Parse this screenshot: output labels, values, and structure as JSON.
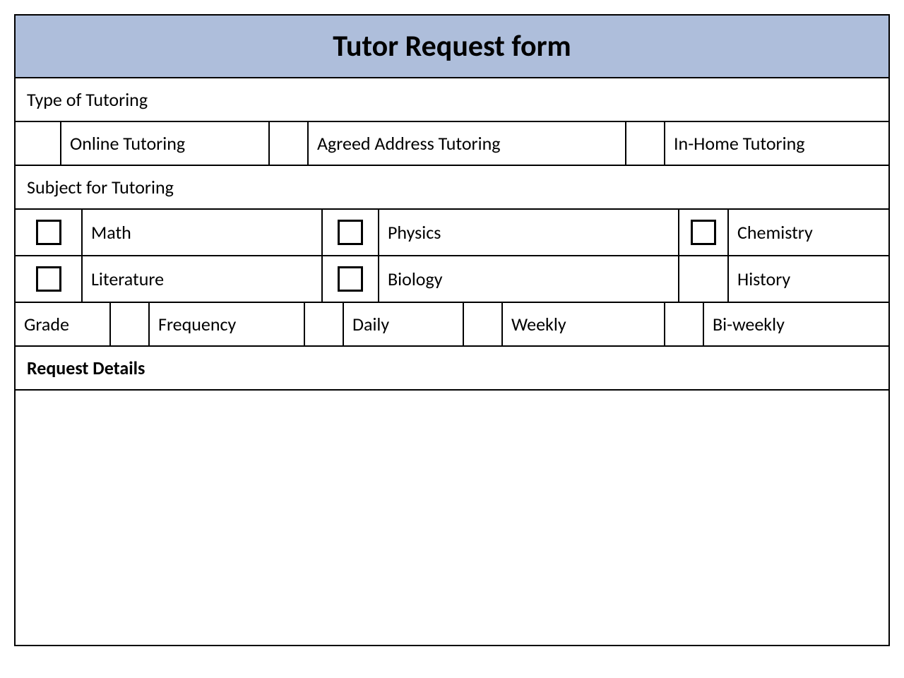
{
  "header": {
    "title": "Tutor Request form"
  },
  "sections": {
    "type_label": "Type of Tutoring",
    "type_options": {
      "online": "Online Tutoring",
      "agreed": "Agreed Address Tutoring",
      "inhome": "In-Home Tutoring"
    },
    "subject_label": "Subject for Tutoring",
    "subjects": {
      "math": "Math",
      "physics": "Physics",
      "chemistry": "Chemistry",
      "literature": "Literature",
      "biology": "Biology",
      "history": "History"
    },
    "grade_label": "Grade",
    "frequency_label": "Frequency",
    "frequency_options": {
      "daily": "Daily",
      "weekly": "Weekly",
      "biweekly": "Bi-weekly"
    },
    "request_details_label": "Request Details"
  }
}
